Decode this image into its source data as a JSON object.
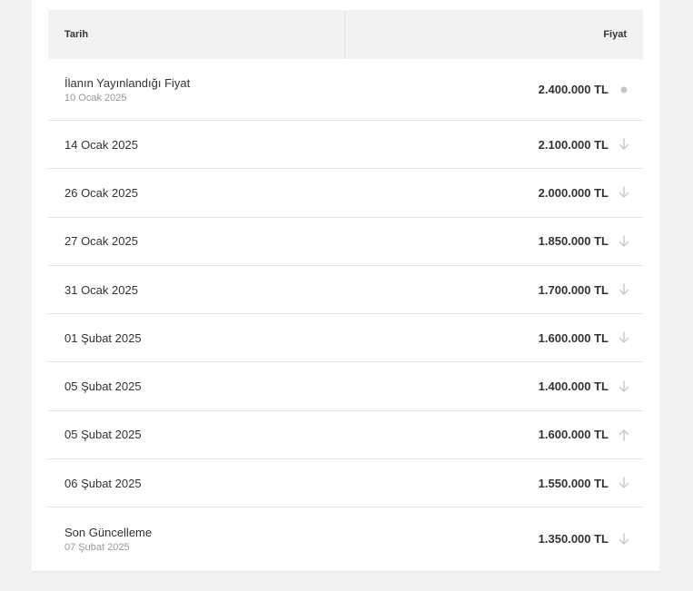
{
  "header": {
    "date_label": "Tarih",
    "price_label": "Fiyat"
  },
  "rows": [
    {
      "title": "İlanın Yayınlandığı Fiyat",
      "subtitle": "10 Ocak 2025",
      "price": "2.400.000 TL",
      "trend": "dot-icon"
    },
    {
      "title": "14 Ocak 2025",
      "price": "2.100.000 TL",
      "trend": "arrow-down-icon"
    },
    {
      "title": "26 Ocak 2025",
      "price": "2.000.000 TL",
      "trend": "arrow-down-icon"
    },
    {
      "title": "27 Ocak 2025",
      "price": "1.850.000 TL",
      "trend": "arrow-down-icon"
    },
    {
      "title": "31 Ocak 2025",
      "price": "1.700.000 TL",
      "trend": "arrow-down-icon"
    },
    {
      "title": "01 Şubat 2025",
      "price": "1.600.000 TL",
      "trend": "arrow-down-icon"
    },
    {
      "title": "05 Şubat 2025",
      "price": "1.400.000 TL",
      "trend": "arrow-down-icon"
    },
    {
      "title": "05 Şubat 2025",
      "price": "1.600.000 TL",
      "trend": "arrow-up-icon"
    },
    {
      "title": "06 Şubat 2025",
      "price": "1.550.000 TL",
      "trend": "arrow-down-icon"
    },
    {
      "title": "Son Güncelleme",
      "subtitle": "07 Şubat 2025",
      "price": "1.350.000 TL",
      "trend": "arrow-down-icon"
    }
  ],
  "colors": {
    "icon": "#c7c7c7",
    "header_bg": "#f2f2f2",
    "divider": "#e6e6e6"
  }
}
